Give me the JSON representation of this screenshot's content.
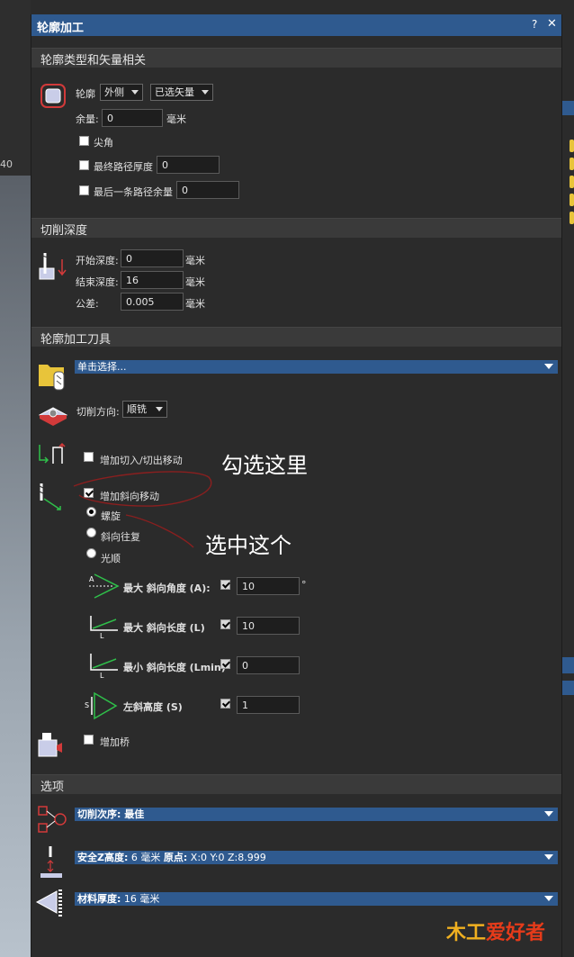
{
  "background": {
    "ruler_label": "40"
  },
  "window": {
    "title": "轮廓加工",
    "help": "?",
    "close": "✕"
  },
  "section1": {
    "title": "轮廓类型和矢量相关",
    "contour_label": "轮廓",
    "contour_side": "外侧",
    "vector_select": "已选矢量",
    "allowance_label": "余量:",
    "allowance_value": "0",
    "allowance_unit": "毫米",
    "sharp_corner": "尖角",
    "final_pass_label": "最终路径厚度",
    "final_pass_value": "0",
    "last_pass_label": "最后一条路径余量",
    "last_pass_value": "0"
  },
  "section2": {
    "title": "切削深度",
    "start_label": "开始深度:",
    "start_value": "0",
    "end_label": "结束深度:",
    "end_value": "16",
    "tol_label": "公差:",
    "tol_value": "0.005",
    "unit": "毫米"
  },
  "section3": {
    "title": "轮廓加工刀具",
    "tool_select": "单击选择...",
    "cut_dir_label": "切削方向:",
    "cut_dir_value": "顺铣",
    "leadin_label": "增加切入/切出移动",
    "ramp_label": "增加斜向移动",
    "radio_spiral": "螺旋",
    "radio_zigzag": "斜向往复",
    "radio_smooth": "光顺",
    "max_angle_label": "最大 斜向角度 (A):",
    "max_angle_value": "10",
    "max_angle_unit": "°",
    "max_len_label": "最大 斜向长度 (L)",
    "max_len_value": "10",
    "min_len_label": "最小 斜向长度 (Lmin)",
    "min_len_value": "0",
    "left_height_label": "左斜高度 (S)",
    "left_height_value": "1",
    "bridge_label": "增加桥",
    "icon_angle_text": "A",
    "icon_len_text": "L",
    "icon_minlen_text": "L",
    "icon_s_text": "S"
  },
  "section4": {
    "title": "选项",
    "order_bar": "切削次序: 最佳",
    "safe_bar_a": "安全Z高度:",
    "safe_bar_b": " 6 毫米 ",
    "safe_bar_c": "原点:",
    "safe_bar_d": " X:0 Y:0 Z:8.999",
    "thick_bar_a": "材料厚度:",
    "thick_bar_b": " 16 毫米"
  },
  "annotations": {
    "check_here": "勾选这里",
    "select_this": "选中这个"
  },
  "watermark": {
    "a": "木工",
    "b": "爱好者"
  },
  "colors": {
    "titlebar": "#2f5a8f",
    "accent_green": "#2fbf4a",
    "accent_red": "#d23a3a"
  }
}
